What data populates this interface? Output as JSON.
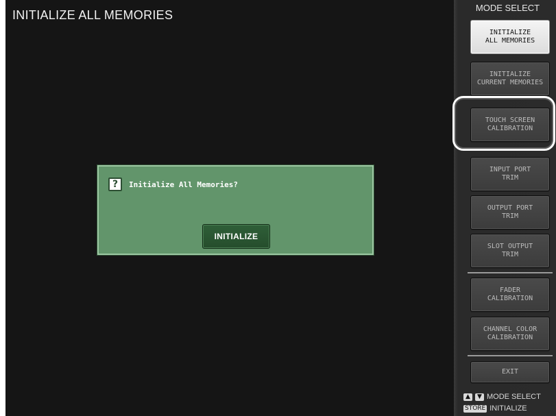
{
  "page": {
    "title": "INITIALIZE ALL MEMORIES"
  },
  "sidebar": {
    "header": "MODE SELECT",
    "buttons": [
      {
        "label": "INITIALIZE\nALL MEMORIES",
        "active": true
      },
      {
        "label": "INITIALIZE\nCURRENT MEMORIES"
      },
      {
        "label": "TOUCH SCREEN\nCALIBRATION",
        "highlighted": true
      },
      {
        "label": "INPUT PORT\nTRIM"
      },
      {
        "label": "OUTPUT PORT\nTRIM"
      },
      {
        "label": "SLOT OUTPUT\nTRIM"
      },
      {
        "label": "FADER\nCALIBRATION"
      },
      {
        "label": "CHANNEL COLOR\nCALIBRATION"
      }
    ],
    "exit_label": "EXIT",
    "legend": {
      "up_key": "▲",
      "down_key": "▼",
      "mode_select_text": "MODE SELECT",
      "store_key": "STORE",
      "initialize_text": "INITIALIZE"
    }
  },
  "dialog": {
    "icon": "question-icon",
    "icon_glyph": "?",
    "message": "Initialize All Memories?",
    "button_label": "INITIALIZE"
  },
  "colors": {
    "screen_bg": "#151515",
    "panel_bg": "#2b2b2b",
    "dialog_bg": "#62956b",
    "dialog_button": "#2a5631",
    "active_button": "#ececec"
  }
}
